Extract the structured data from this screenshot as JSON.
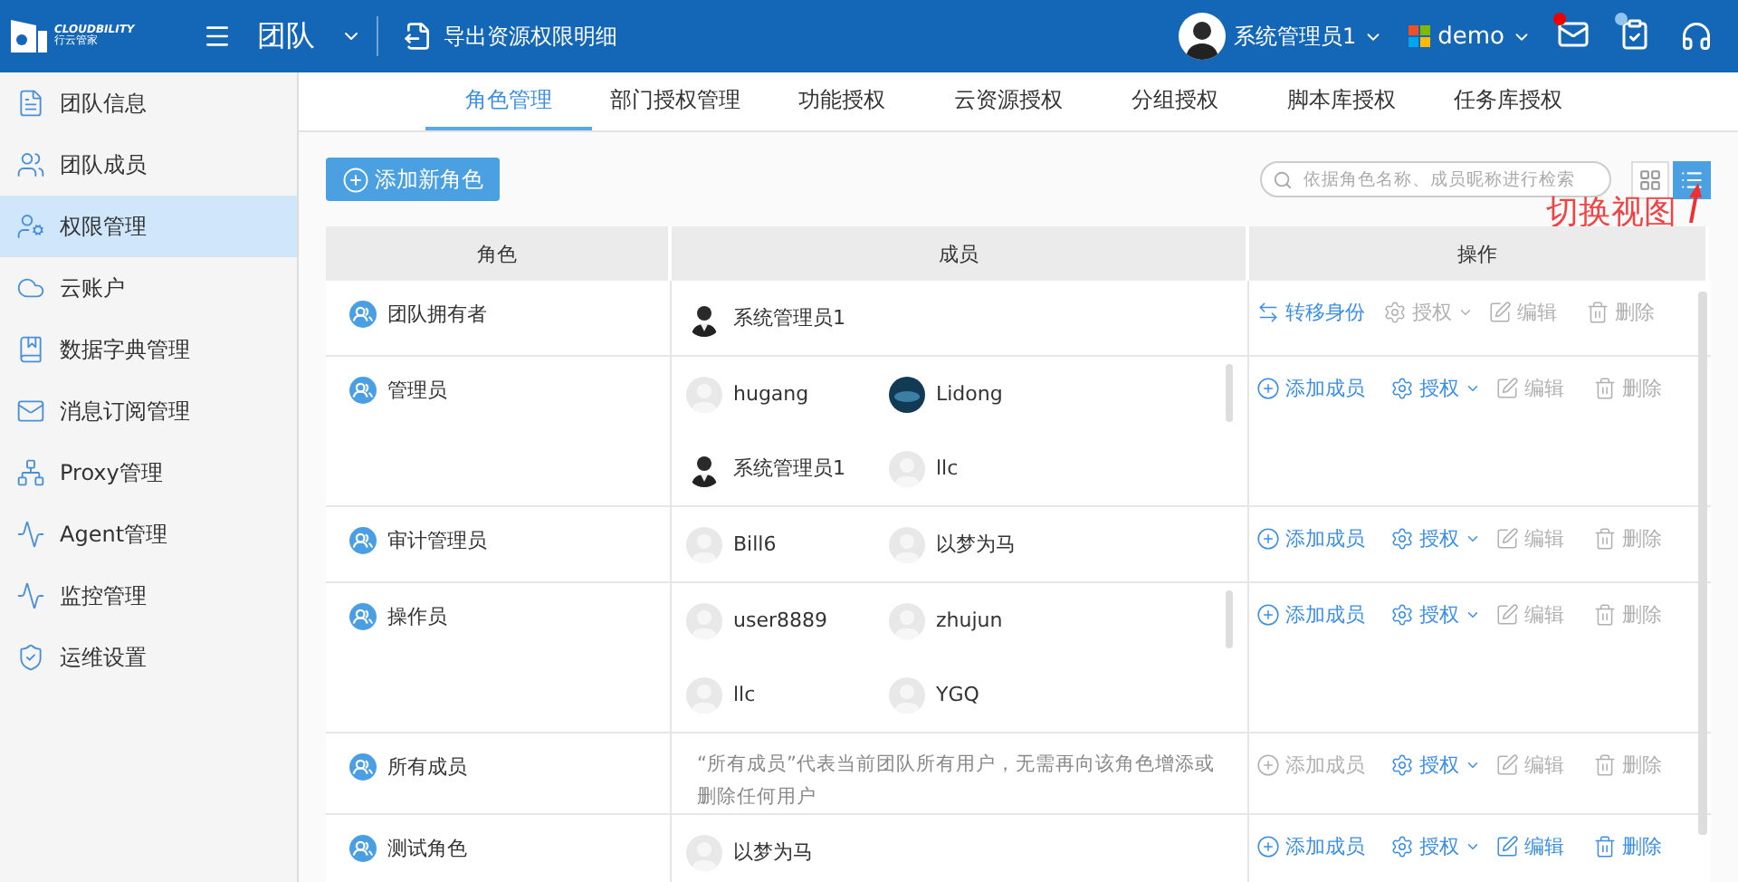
{
  "header": {
    "logo": {
      "brand": "CLOUDBILITY",
      "subtitle": "行云管家"
    },
    "title": "团队",
    "export_link": "导出资源权限明细",
    "user": "系统管理员1",
    "org": "demo",
    "mail_unread": true
  },
  "sidebar": {
    "items": [
      {
        "label": "团队信息",
        "selected": false
      },
      {
        "label": "团队成员",
        "selected": false
      },
      {
        "label": "权限管理",
        "selected": true
      },
      {
        "label": "云账户",
        "selected": false
      },
      {
        "label": "数据字典管理",
        "selected": false
      },
      {
        "label": "消息订阅管理",
        "selected": false
      },
      {
        "label": "Proxy管理",
        "selected": false
      },
      {
        "label": "Agent管理",
        "selected": false
      },
      {
        "label": "监控管理",
        "selected": false
      },
      {
        "label": "运维设置",
        "selected": false
      }
    ]
  },
  "tabs": [
    {
      "label": "角色管理",
      "selected": true
    },
    {
      "label": "部门授权管理",
      "selected": false
    },
    {
      "label": "功能授权",
      "selected": false
    },
    {
      "label": "云资源授权",
      "selected": false
    },
    {
      "label": "分组授权",
      "selected": false
    },
    {
      "label": "脚本库授权",
      "selected": false
    },
    {
      "label": "任务库授权",
      "selected": false
    }
  ],
  "toolbar": {
    "add_button": "添加新角色",
    "search": {
      "placeholder": "依据角色名称、成员昵称进行检索"
    },
    "views": [
      {
        "kind": "grid",
        "selected": false
      },
      {
        "kind": "list",
        "selected": true
      }
    ],
    "annotation": "切换视图"
  },
  "table": {
    "columns": [
      "角色",
      "成员",
      "操作"
    ],
    "rows": [
      {
        "role": "团队拥有者",
        "members": [
          {
            "name": "系统管理员1",
            "kind": "photo"
          }
        ],
        "actions": [
          {
            "kind": "transfer",
            "label": "转移身份",
            "disabled": false
          },
          {
            "kind": "authorize",
            "label": "授权",
            "disabled": true
          },
          {
            "kind": "edit",
            "label": "编辑",
            "disabled": true
          },
          {
            "kind": "delete",
            "label": "删除",
            "disabled": true
          }
        ]
      },
      {
        "role": "管理员",
        "members": [
          {
            "name": "hugang",
            "kind": "default"
          },
          {
            "name": "Lidong",
            "kind": "dark"
          },
          {
            "name": "系统管理员1",
            "kind": "photo"
          },
          {
            "name": "llc",
            "kind": "default"
          }
        ],
        "actions": [
          {
            "kind": "add",
            "label": "添加成员",
            "disabled": false
          },
          {
            "kind": "authorize",
            "label": "授权",
            "disabled": false
          },
          {
            "kind": "edit",
            "label": "编辑",
            "disabled": true
          },
          {
            "kind": "delete",
            "label": "删除",
            "disabled": true
          }
        ]
      },
      {
        "role": "审计管理员",
        "members": [
          {
            "name": "Bill6",
            "kind": "default"
          },
          {
            "name": "以梦为马",
            "kind": "default"
          }
        ],
        "actions": [
          {
            "kind": "add",
            "label": "添加成员",
            "disabled": false
          },
          {
            "kind": "authorize",
            "label": "授权",
            "disabled": false
          },
          {
            "kind": "edit",
            "label": "编辑",
            "disabled": true
          },
          {
            "kind": "delete",
            "label": "删除",
            "disabled": true
          }
        ]
      },
      {
        "role": "操作员",
        "members": [
          {
            "name": "user8889",
            "kind": "default"
          },
          {
            "name": "zhujun",
            "kind": "default"
          },
          {
            "name": "llc",
            "kind": "default"
          },
          {
            "name": "YGQ",
            "kind": "default"
          }
        ],
        "actions": [
          {
            "kind": "add",
            "label": "添加成员",
            "disabled": false
          },
          {
            "kind": "authorize",
            "label": "授权",
            "disabled": false
          },
          {
            "kind": "edit",
            "label": "编辑",
            "disabled": true
          },
          {
            "kind": "delete",
            "label": "删除",
            "disabled": true
          }
        ]
      },
      {
        "role": "所有成员",
        "note": "“所有成员”代表当前团队所有用户，无需再向该角色增添或删除任何用户",
        "actions": [
          {
            "kind": "add",
            "label": "添加成员",
            "disabled": true
          },
          {
            "kind": "authorize",
            "label": "授权",
            "disabled": false
          },
          {
            "kind": "edit",
            "label": "编辑",
            "disabled": true
          },
          {
            "kind": "delete",
            "label": "删除",
            "disabled": true
          }
        ]
      },
      {
        "role": "测试角色",
        "members": [
          {
            "name": "以梦为马",
            "kind": "default"
          }
        ],
        "actions": [
          {
            "kind": "add",
            "label": "添加成员",
            "disabled": false
          },
          {
            "kind": "authorize",
            "label": "授权",
            "disabled": false
          },
          {
            "kind": "edit",
            "label": "编辑",
            "disabled": false
          },
          {
            "kind": "delete",
            "label": "删除",
            "disabled": false
          }
        ]
      }
    ]
  }
}
